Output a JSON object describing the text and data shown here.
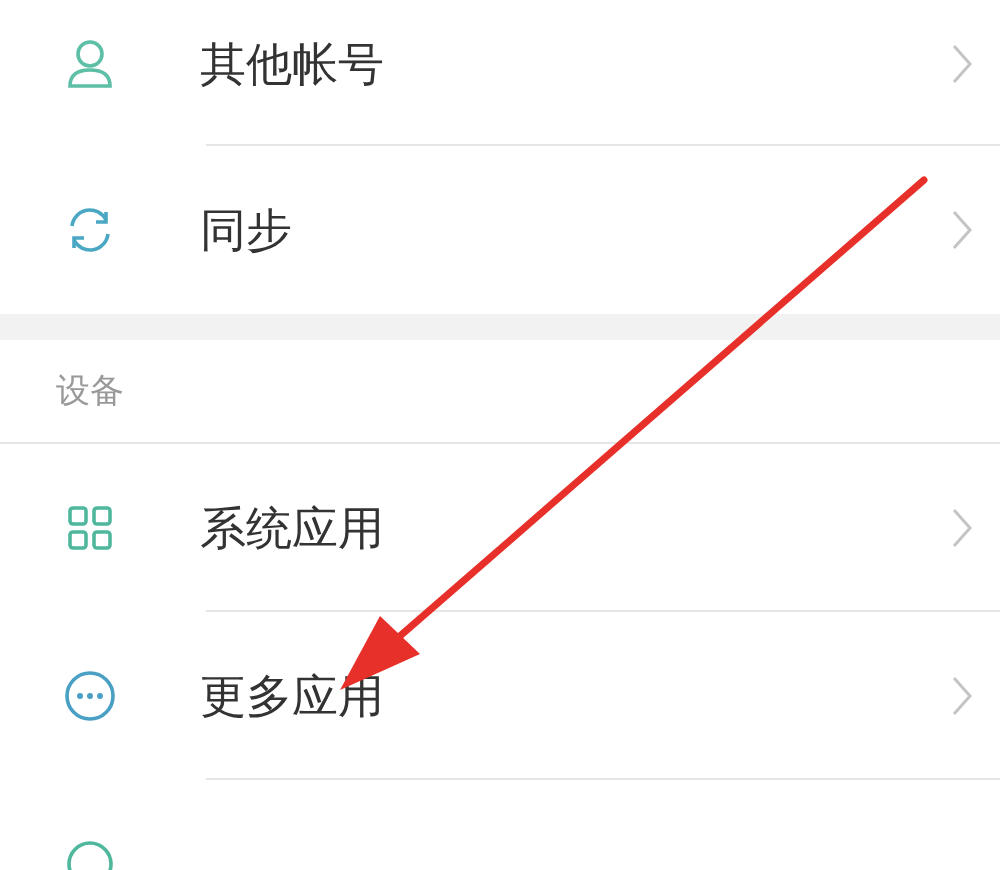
{
  "groups": [
    {
      "items": [
        {
          "label": "其他帐号"
        },
        {
          "label": "同步"
        }
      ]
    },
    {
      "header": "设备",
      "items": [
        {
          "label": "系统应用"
        },
        {
          "label": "更多应用"
        }
      ]
    }
  ]
}
